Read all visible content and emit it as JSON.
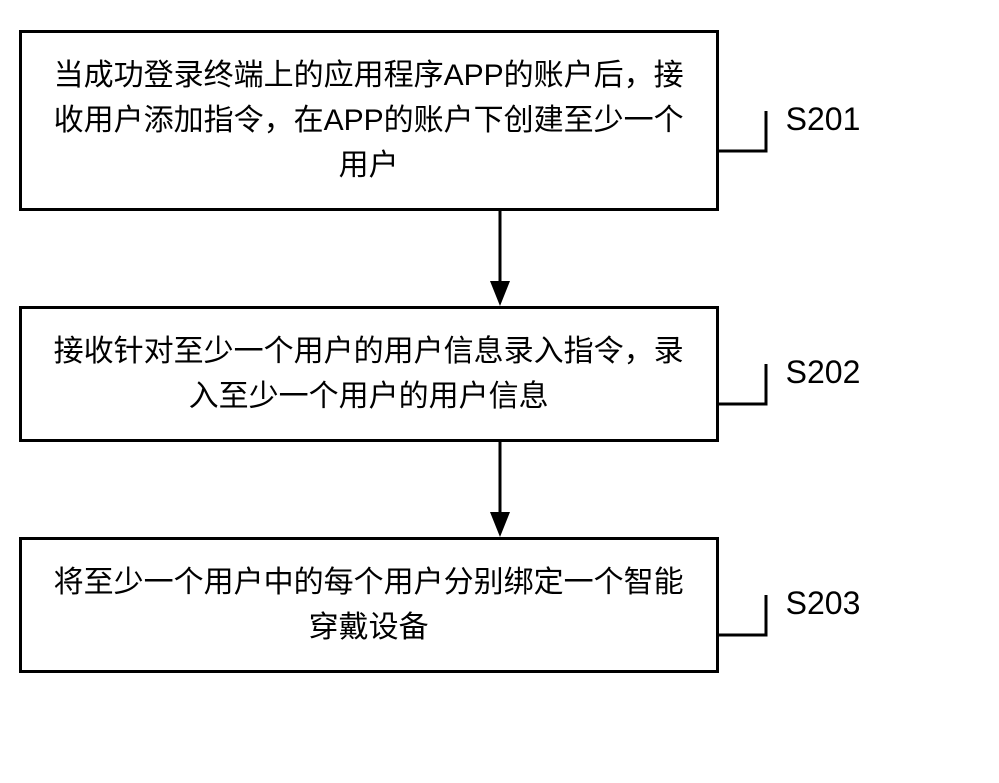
{
  "flowchart": {
    "steps": [
      {
        "text": "当成功登录终端上的应用程序APP的账户后，接收用户添加指令，在APP的账户下创建至少一个用户",
        "label": "S201"
      },
      {
        "text": "接收针对至少一个用户的用户信息录入指令，录入至少一个用户的用户信息",
        "label": "S202"
      },
      {
        "text": "将至少一个用户中的每个用户分别绑定一个智能穿戴设备",
        "label": "S203"
      }
    ]
  }
}
